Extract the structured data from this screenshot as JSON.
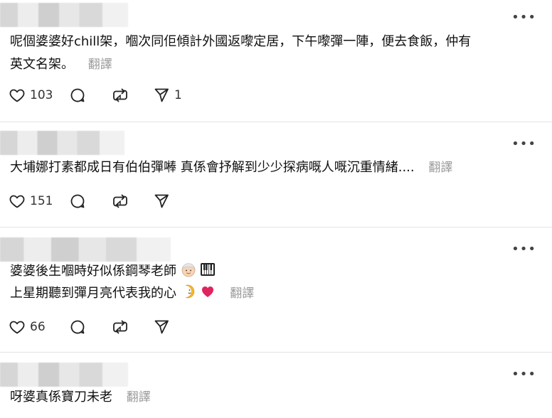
{
  "comments": [
    {
      "text_line1": "呢個婆婆好chill架，嗰次同佢傾計外國返嚟定居，下午嚟彈一陣，便去食飯，仲有",
      "text_line2": "英文名架。",
      "translate": "翻譯",
      "likes": "103",
      "shares": "1"
    },
    {
      "text_line1": "大埔娜打素都成日有伯伯彈𠾴 真係會抒解到少少探病嘅人嘅沉重情緒....",
      "translate": "翻譯",
      "likes": "151"
    },
    {
      "text_line1": "婆婆後生嗰時好似係鋼琴老師",
      "text_line2": "上星期聽到彈月亮代表我的心",
      "translate": "翻譯",
      "likes": "66"
    },
    {
      "text_line1": "呀婆真係寶刀未老",
      "translate": "翻譯"
    }
  ],
  "icons": {
    "more": "more-horizontal-icon",
    "like": "heart-icon",
    "reply": "comment-bubble-icon",
    "repost": "repost-icon",
    "share": "send-icon"
  },
  "colors": {
    "text": "#101010",
    "muted": "#999999",
    "heart": "#e0245e"
  }
}
